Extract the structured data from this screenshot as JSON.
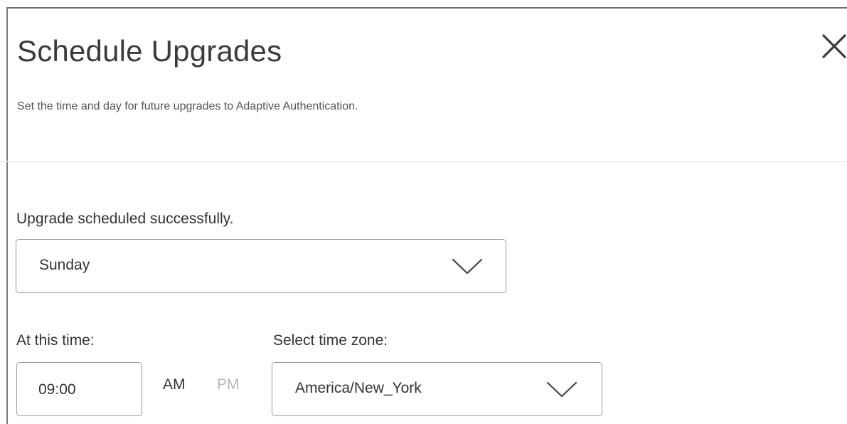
{
  "dialog": {
    "title": "Schedule Upgrades",
    "subtitle": "Set the time and day for future upgrades to Adaptive Authentication.",
    "status_message": "Upgrade scheduled successfully.",
    "close_icon": "close-icon"
  },
  "day_select": {
    "selected": "Sunday",
    "icon": "chevron-down-icon"
  },
  "time": {
    "label": "At this time:",
    "value": "09:00",
    "am_label": "AM",
    "pm_label": "PM",
    "selected_period": "AM"
  },
  "timezone": {
    "label": "Select time zone:",
    "selected": "America/New_York",
    "icon": "chevron-down-icon"
  },
  "colors": {
    "title_text": "#3b3b3b",
    "border": "#9a9a9a",
    "inactive_text": "#b8b8b8"
  }
}
